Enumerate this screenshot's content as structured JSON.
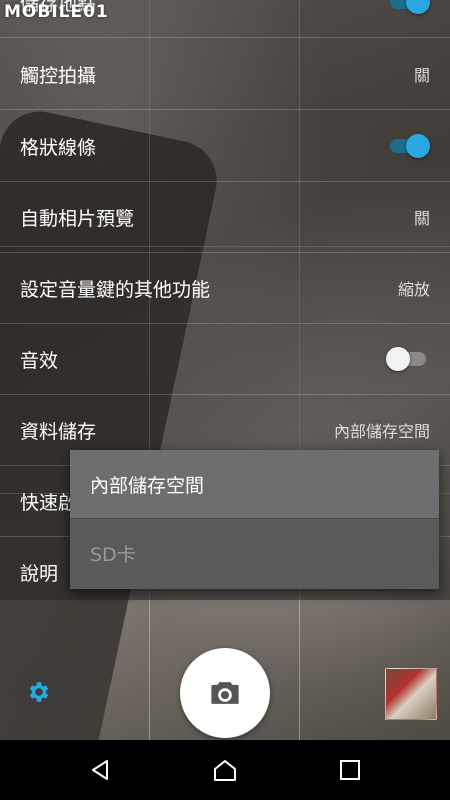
{
  "watermark": "MOBILE01",
  "settings": {
    "items": [
      {
        "label": "儲存地點",
        "control": "toggle",
        "state": "on"
      },
      {
        "label": "觸控拍攝",
        "value": "關"
      },
      {
        "label": "格狀線條",
        "control": "toggle",
        "state": "on"
      },
      {
        "label": "自動相片預覽",
        "value": "關"
      },
      {
        "label": "設定音量鍵的其他功能",
        "value": "縮放"
      },
      {
        "label": "音效",
        "control": "toggle",
        "state": "off"
      },
      {
        "label": "資料儲存",
        "value": "內部儲存空間"
      },
      {
        "label": "快速啟動"
      },
      {
        "label": "說明"
      }
    ]
  },
  "dropdown": {
    "options": [
      {
        "label": "內部儲存空間",
        "selected": true
      },
      {
        "label": "SD卡",
        "enabled": false
      }
    ]
  },
  "camera_controls": {
    "settings_icon": "gear-icon",
    "shutter_icon": "camera-icon",
    "thumbnail": "last-photo-thumbnail"
  },
  "navigation": {
    "icons": [
      "back-icon",
      "home-icon",
      "recents-icon"
    ]
  },
  "colors": {
    "toggle_on": "#2aa7e0",
    "toggle_off": "#f2f2f2",
    "dropdown_bg": "#5a5a5a",
    "navbar_bg": "#000000"
  }
}
